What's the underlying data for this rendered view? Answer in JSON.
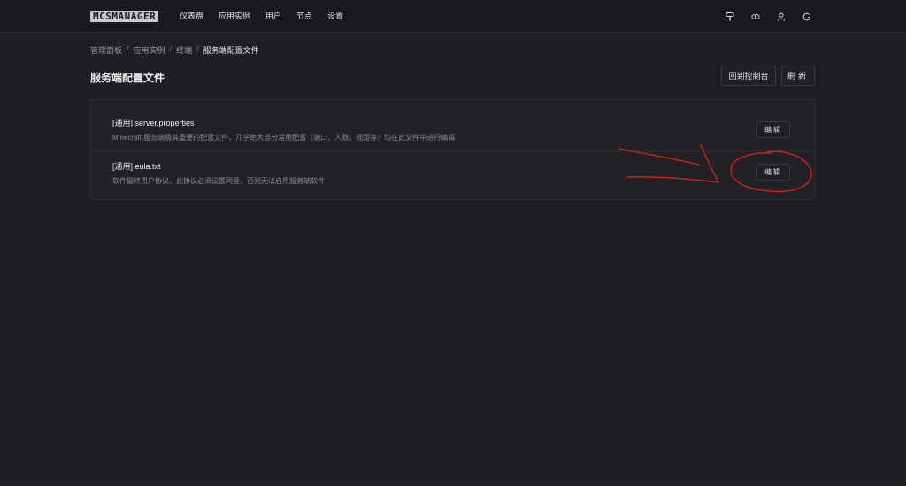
{
  "header": {
    "logo": "MCSMANAGER",
    "nav": [
      "仪表盘",
      "应用实例",
      "用户",
      "节点",
      "设置"
    ],
    "icons": [
      "theme-brush-icon",
      "language-icon",
      "user-icon",
      "logout-icon"
    ]
  },
  "breadcrumb": {
    "items": [
      "管理面板",
      "应用实例",
      "终端",
      "服务端配置文件"
    ],
    "separator": "/"
  },
  "page": {
    "title": "服务端配置文件",
    "console_button": "回到控制台",
    "refresh_button": "刷新"
  },
  "files": [
    {
      "title": "[通用] server.properties",
      "description": "Minecraft 服务端极其重要的配置文件，几乎绝大部分常用配置（端口，人数，视距等）均在此文件中进行编辑",
      "action": "编辑"
    },
    {
      "title": "[通用] eula.txt",
      "description": "软件最终用户协议，此协议必须设置同意，否则无法启用服务端软件",
      "action": "编辑"
    }
  ],
  "colors": {
    "background": "#1e1f23",
    "topbar": "#18191c",
    "annotation": "#e0201a"
  }
}
